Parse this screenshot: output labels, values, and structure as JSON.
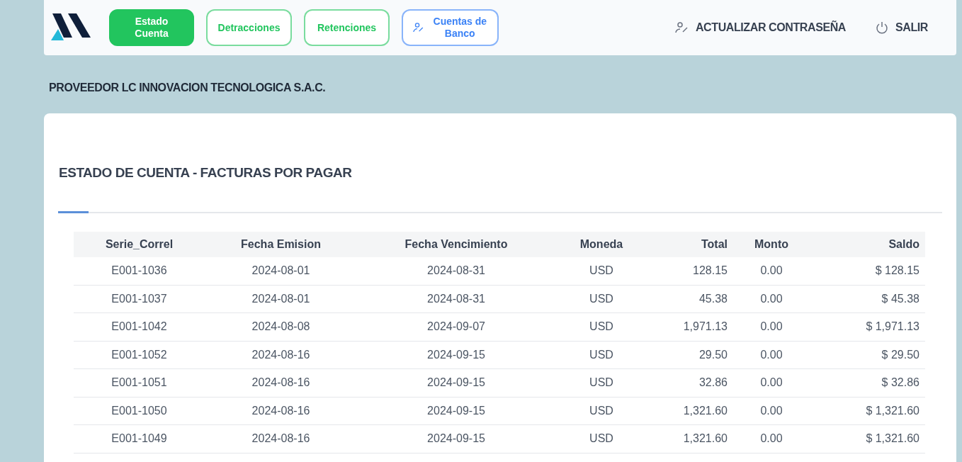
{
  "nav": {
    "tabs": [
      {
        "label": "Estado Cuenta",
        "selected": true,
        "color": "#22c55e",
        "icon": false
      },
      {
        "label": "Detracciones",
        "selected": false,
        "color": "#22c55e",
        "icon": false
      },
      {
        "label": "Retenciones",
        "selected": false,
        "color": "#22c55e",
        "icon": false
      },
      {
        "label": "Cuentas de Banco",
        "selected": false,
        "color": "#3b82f6",
        "icon": true
      }
    ],
    "actions": [
      {
        "kind": "password",
        "label": "ACTUALIZAR CONTRASEÑA"
      },
      {
        "kind": "logout",
        "label": "SALIR"
      }
    ]
  },
  "provider": "PROVEEDOR LC INNOVACION TECNOLOGICA S.A.C.",
  "card": {
    "title": "ESTADO DE CUENTA - FACTURAS POR PAGAR",
    "table": {
      "columns": [
        "Serie_Correl",
        "Fecha Emision",
        "Fecha Vencimiento",
        "Moneda",
        "Total",
        "Monto",
        "Saldo"
      ],
      "rows": [
        [
          "E001-1036",
          "2024-08-01",
          "2024-08-31",
          "USD",
          "128.15",
          "0.00",
          "$ 128.15"
        ],
        [
          "E001-1037",
          "2024-08-01",
          "2024-08-31",
          "USD",
          "45.38",
          "0.00",
          "$ 45.38"
        ],
        [
          "E001-1042",
          "2024-08-08",
          "2024-09-07",
          "USD",
          "1,971.13",
          "0.00",
          "$ 1,971.13"
        ],
        [
          "E001-1052",
          "2024-08-16",
          "2024-09-15",
          "USD",
          "29.50",
          "0.00",
          "$ 29.50"
        ],
        [
          "E001-1051",
          "2024-08-16",
          "2024-09-15",
          "USD",
          "32.86",
          "0.00",
          "$ 32.86"
        ],
        [
          "E001-1050",
          "2024-08-16",
          "2024-09-15",
          "USD",
          "1,321.60",
          "0.00",
          "$ 1,321.60"
        ],
        [
          "E001-1049",
          "2024-08-16",
          "2024-09-15",
          "USD",
          "1,321.60",
          "0.00",
          "$ 1,321.60"
        ]
      ]
    }
  }
}
